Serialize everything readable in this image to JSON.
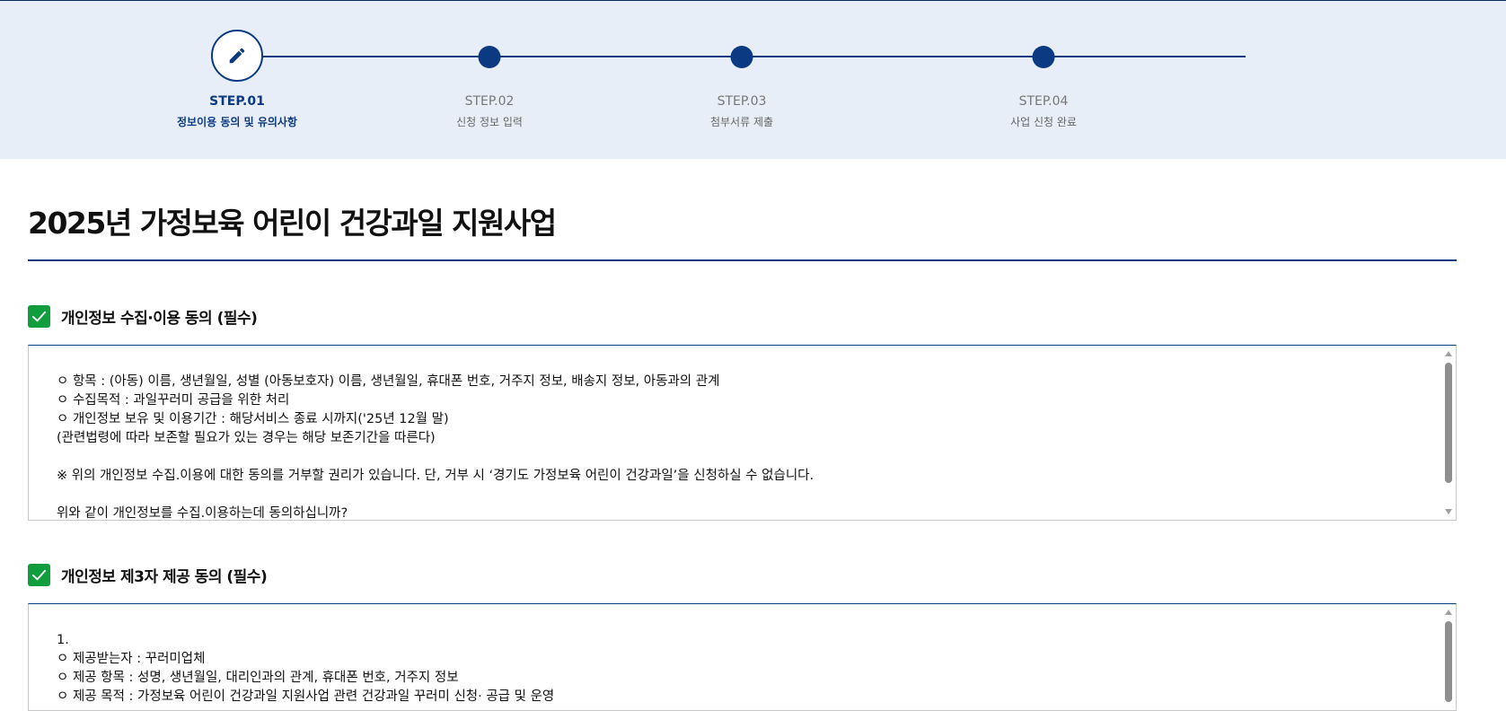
{
  "steps": [
    {
      "num": "STEP.01",
      "desc": "정보이용 동의 및 유의사항",
      "state": "current",
      "icon": "pencil-icon"
    },
    {
      "num": "STEP.02",
      "desc": "신청 정보 입력",
      "state": "upcoming"
    },
    {
      "num": "STEP.03",
      "desc": "첨부서류 제출",
      "state": "upcoming"
    },
    {
      "num": "STEP.04",
      "desc": "사업 신청 완료",
      "state": "upcoming"
    }
  ],
  "page_title": "2025년 가정보육 어린이 건강과일 지원사업",
  "sections": [
    {
      "title": "개인정보 수집·이용 동의 (필수)",
      "checked": true,
      "lines": [
        "ㅇ 항목 : (아동) 이름, 생년월일, 성별 (아동보호자) 이름, 생년월일, 휴대폰 번호, 거주지 정보, 배송지 정보, 아동과의 관계",
        "ㅇ 수집목적 : 과일꾸러미 공급을 위한 처리",
        "ㅇ 개인정보 보유 및 이용기간 : 해당서비스 종료 시까지('25년 12월 말)",
        " (관련법령에 따라 보존할 필요가 있는 경우는 해당 보존기간을 따른다)",
        "",
        "※ 위의 개인정보 수집.이용에 대한 동의를 거부할 권리가 있습니다. 단, 거부 시 ‘경기도 가정보육 어린이 건강과일’을 신청하실 수 없습니다.",
        "",
        "위와 같이 개인정보를 수집.이용하는데 동의하십니까?"
      ]
    },
    {
      "title": "개인정보 제3자 제공 동의 (필수)",
      "checked": true,
      "lines": [
        "1.",
        "ㅇ 제공받는자 : 꾸러미업체",
        "ㅇ 제공 항목 : 성명, 생년월일, 대리인과의 관계, 휴대폰 번호, 거주지 정보",
        "ㅇ 제공 목적 : 가정보육 어린이 건강과일 지원사업 관련 건강과일 꾸러미 신청· 공급 및 운영"
      ]
    }
  ],
  "colors": {
    "primary": "#0b3a82",
    "check_green": "#0f9d3d",
    "stepbar_bg": "#e8eef8"
  }
}
